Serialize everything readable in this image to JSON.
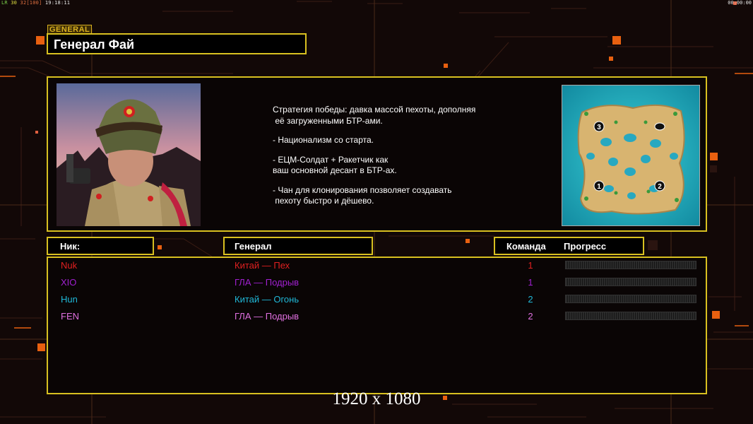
{
  "status_bar": {
    "left_prefix": "LR",
    "left_a": "30",
    "left_b": "32",
    "left_c": "[100]",
    "left_time": "19:18:11",
    "right_time": "00:00:00"
  },
  "general_tag": "GENERAL",
  "general_title": "Генерал Фай",
  "strategy_lines": [
    "Стратегия победы: давка массой пехоты, дополняя",
    " её загруженными БТР-ами.",
    "",
    "- Национализм со старта.",
    "",
    "- ЕЦМ-Солдат + Ракетчик как",
    "ваш основной десант в БТР-ах.",
    "",
    "- Чан для клонирования позволяет создавать",
    " пехоту быстро и дёшево."
  ],
  "minimap": {
    "start_positions": [
      "1",
      "2",
      "3"
    ]
  },
  "headers": {
    "nick": "Ник:",
    "general": "Генерал",
    "team": "Команда",
    "progress": "Прогресс"
  },
  "players": [
    {
      "nick": "Nuk",
      "general": "Китай — Пех",
      "team": "1",
      "color": "#e02020",
      "progress": 0
    },
    {
      "nick": "XIO",
      "general": "ГЛА — Подрыв",
      "team": "1",
      "color": "#a020d0",
      "progress": 0
    },
    {
      "nick": "Hun",
      "general": "Китай — Огонь",
      "team": "2",
      "color": "#20b8d8",
      "progress": 0
    },
    {
      "nick": "FEN",
      "general": "ГЛА — Подрыв",
      "team": "2",
      "color": "#e070e0",
      "progress": 0
    }
  ],
  "resolution_caption": "1920 x 1080",
  "colors": {
    "frame": "#d8c020",
    "accent_orange": "#e86010",
    "background": "#120807"
  }
}
